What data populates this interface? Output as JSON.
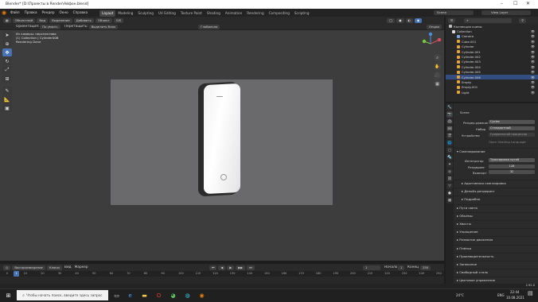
{
  "window": {
    "title": "Blender* [D:\\Проекты в Render\\Айфон.blend]"
  },
  "menubar": {
    "items": [
      "Файл",
      "Правка",
      "Рендер",
      "Окно",
      "Справка"
    ],
    "workspaces": [
      "Layout",
      "Modeling",
      "Sculpting",
      "UV Editing",
      "Texture Paint",
      "Shading",
      "Animation",
      "Rendering",
      "Compositing",
      "Scripting"
    ],
    "active_workspace": "Layout",
    "scene": "Scene",
    "view_layer": "View Layer"
  },
  "viewport_header": {
    "mode": "Объектный",
    "view": "Вид",
    "select": "Выделение",
    "add": "Добавить",
    "object": "Объект",
    "gis": "GIS",
    "orientation_label": "Ориентация:",
    "orientation_value": "По умолч.",
    "drag": "Перетащить:",
    "drag_value": "Выделить блок",
    "global": "Глобально",
    "options": "Опции"
  },
  "viewport_info": {
    "line1": "Из камеры: перспектива",
    "line2": "(1) Collection | Cylinder006",
    "line3": "Rendering Done"
  },
  "outliner": {
    "title": "Коллекция сцены",
    "rows": [
      {
        "label": "Collection",
        "color": "#dddddd"
      },
      {
        "label": "Camera",
        "color": "#7aa5d8"
      },
      {
        "label": "Cube.001",
        "color": "#e8a23c"
      },
      {
        "label": "Cylinder",
        "color": "#e8a23c"
      },
      {
        "label": "Cylinder.001",
        "color": "#e8a23c"
      },
      {
        "label": "Cylinder.002",
        "color": "#e8a23c"
      },
      {
        "label": "Cylinder.003",
        "color": "#e8a23c"
      },
      {
        "label": "Cylinder.004",
        "color": "#e8a23c"
      },
      {
        "label": "Cylinder.005",
        "color": "#e8a23c"
      },
      {
        "label": "Cylinder.006",
        "color": "#e8a23c"
      },
      {
        "label": "Empty",
        "color": "#e8a23c"
      },
      {
        "label": "Empty.001",
        "color": "#e8a23c"
      },
      {
        "label": "Light",
        "color": "#e8a23c"
      }
    ],
    "selected_index": 9
  },
  "properties": {
    "scene_label": "Scene",
    "render_engine_label": "Рендер-движок",
    "render_engine": "Cycles",
    "feature_label": "Набор",
    "feature": "Стандартный",
    "device_label": "Устройство",
    "device": "Графический процессор",
    "open_shading": "Open Shading Language",
    "sampling": "Сэмплирование",
    "integrator_label": "Интегратор",
    "integrator": "Трассировка путей",
    "render_label": "Рендеринг",
    "render_val": "128",
    "viewport_label": "Вьюпорт",
    "viewport_val": "32",
    "sections": [
      "Адаптивная сэмплировка",
      "Денойз-рендеринг",
      "Подробно",
      "Пути света",
      "Объёмы",
      "Хвосты",
      "Упрощение",
      "Размытие движения",
      "Плёнка",
      "Производительность",
      "Запекание",
      "Свободный стиль",
      "Цветовое управление"
    ]
  },
  "timeline": {
    "playback": "Воспроизведение",
    "keying": "Ключи",
    "view": "Вид",
    "marker": "Маркер",
    "frame_current": "1",
    "start_label": "Начало",
    "start": "1",
    "end_label": "Конец",
    "end": "250",
    "ticks": [
      "0",
      "10",
      "20",
      "30",
      "40",
      "50",
      "60",
      "70",
      "80",
      "90",
      "100",
      "110",
      "120",
      "130",
      "140",
      "150",
      "160",
      "170",
      "180",
      "190",
      "200",
      "210",
      "220",
      "230",
      "240",
      "250"
    ]
  },
  "statusbar": {
    "version": "2.92.0"
  },
  "taskbar": {
    "search_placeholder": "Чтобы начать поиск, введите здесь запрос",
    "weather": "24°C",
    "lang": "ENG",
    "time": "22:44",
    "date": "10.08.2021"
  }
}
